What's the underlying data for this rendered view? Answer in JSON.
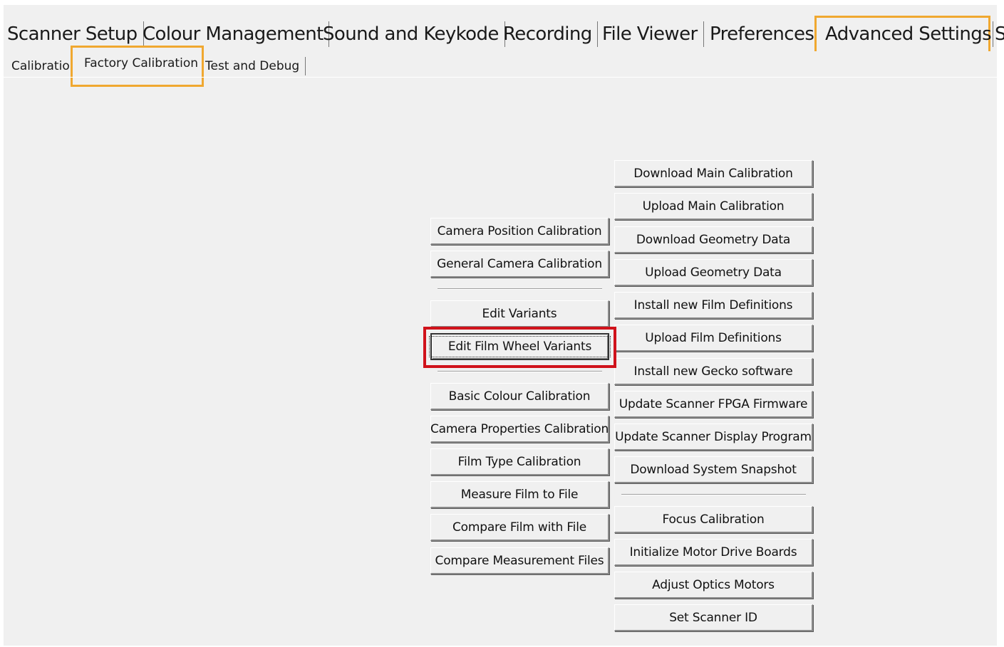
{
  "main_tabs": [
    {
      "label": "Scanner Setup"
    },
    {
      "label": "Colour Management"
    },
    {
      "label": "Sound and Keykode"
    },
    {
      "label": "Recording"
    },
    {
      "label": "File Viewer"
    },
    {
      "label": "Preferences"
    },
    {
      "label": "Advanced Settings"
    },
    {
      "label": "S"
    }
  ],
  "sub_tabs": [
    {
      "label": "Calibration"
    },
    {
      "label": "Factory Calibration"
    },
    {
      "label": "Test and Debug"
    }
  ],
  "left_buttons": {
    "camera_position": "Camera Position Calibration",
    "general_camera": "General Camera Calibration",
    "edit_variants": "Edit Variants",
    "edit_film_wheel": "Edit Film Wheel Variants",
    "basic_colour": "Basic Colour Calibration",
    "camera_properties": "Camera Properties Calibration",
    "film_type": "Film Type Calibration",
    "measure_film": "Measure Film to File",
    "compare_film": "Compare Film with File",
    "compare_measurement": "Compare Measurement Files"
  },
  "right_buttons": {
    "download_main": "Download Main Calibration",
    "upload_main": "Upload Main Calibration",
    "download_geometry": "Download Geometry Data",
    "upload_geometry": "Upload Geometry Data",
    "install_film_defs": "Install new Film Definitions",
    "upload_film_defs": "Upload Film Definitions",
    "install_gecko": "Install new Gecko software",
    "update_fpga": "Update Scanner FPGA Firmware",
    "update_display": "Update Scanner Display Program",
    "download_snapshot": "Download System Snapshot",
    "focus_calibration": "Focus Calibration",
    "init_motor": "Initialize Motor Drive Boards",
    "adjust_optics": "Adjust Optics Motors",
    "set_scanner_id": "Set Scanner ID"
  },
  "colors": {
    "tab_highlight": "#f0a830",
    "focus_highlight": "#d0121b",
    "window_bg": "#f0f0f0"
  }
}
